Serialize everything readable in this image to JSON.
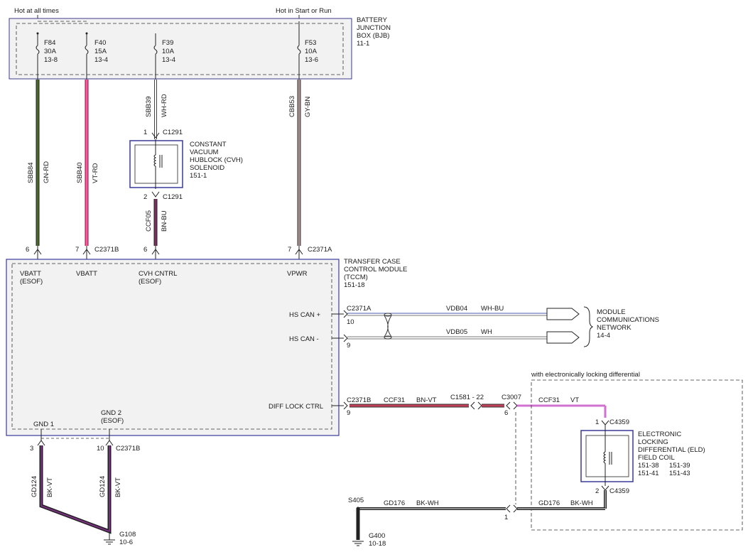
{
  "top": {
    "hot_at_all_times": "Hot at all times",
    "hot_in_start_run": "Hot in Start or Run"
  },
  "bjb": {
    "label_lines": [
      "BATTERY",
      "JUNCTION",
      "BOX (BJB)",
      "11-1"
    ],
    "fuses": [
      {
        "id": "F84",
        "amps": "30A",
        "ref": "13-8"
      },
      {
        "id": "F40",
        "amps": "15A",
        "ref": "13-4"
      },
      {
        "id": "F39",
        "amps": "10A",
        "ref": "13-4"
      },
      {
        "id": "F53",
        "amps": "10A",
        "ref": "13-6"
      }
    ]
  },
  "wires": {
    "sbb84": {
      "circuit": "SBB84",
      "color": "GN-RD",
      "hex": "#4a6a2a"
    },
    "sbb40": {
      "circuit": "SBB40",
      "color": "VT-RD",
      "hex": "#e0287a"
    },
    "sbb39": {
      "circuit": "SBB39",
      "color": "WH-RD"
    },
    "cbb53": {
      "circuit": "CBB53",
      "color": "GY-BN",
      "hex": "#8a7a7a"
    },
    "ccf05": {
      "circuit": "CCF05",
      "color": "BN-BU",
      "hex": "#6a2a4a"
    },
    "vdb04": {
      "circuit": "VDB04",
      "color": "WH-BU"
    },
    "vdb05": {
      "circuit": "VDB05",
      "color": "WH"
    },
    "ccf31_a": {
      "circuit": "CCF31",
      "color": "BN-VT",
      "hex": "#b0304a"
    },
    "ccf31_b": {
      "circuit": "CCF31",
      "color": "VT",
      "hex": "#d060d0"
    },
    "gd124_a": {
      "circuit": "GD124",
      "color": "BK-VT"
    },
    "gd124_b": {
      "circuit": "GD124",
      "color": "BK-VT"
    },
    "gd176_a": {
      "circuit": "GD176",
      "color": "BK-WH"
    },
    "gd176_b": {
      "circuit": "GD176",
      "color": "BK-WH"
    }
  },
  "cvh": {
    "label_lines": [
      "CONSTANT",
      "VACUUM",
      "HUBLOCK (CVH)",
      "SOLENOID",
      "151-1"
    ],
    "pin1": "1",
    "pin2": "2",
    "connector": "C1291"
  },
  "tccm": {
    "label_lines": [
      "TRANSFER CASE",
      "CONTROL MODULE",
      "(TCCM)",
      "151-18"
    ],
    "pins": {
      "vbatt_esof": {
        "pin": "6",
        "name": "VBATT",
        "sub": "(ESOF)"
      },
      "vbatt": {
        "pin": "7",
        "name": "VBATT",
        "conn": "C2371B"
      },
      "cvh_cntrl": {
        "pin": "6",
        "name": "CVH CNTRL",
        "sub": "(ESOF)"
      },
      "vpwr": {
        "pin": "7",
        "name": "VPWR",
        "conn": "C2371A"
      },
      "hs_can_plus": {
        "name": "HS CAN +",
        "pin": "10",
        "conn": "C2371A"
      },
      "hs_can_minus": {
        "name": "HS CAN -",
        "pin": "9"
      },
      "diff_lock": {
        "name": "DIFF LOCK CTRL",
        "pin": "9",
        "conn": "C2371B"
      },
      "gnd1": {
        "name": "GND 1",
        "pin": "3"
      },
      "gnd2": {
        "name": "GND 2",
        "sub": "(ESOF)",
        "pin": "10",
        "conn": "C2371B"
      }
    }
  },
  "network": {
    "label_lines": [
      "MODULE",
      "COMMUNICATIONS",
      "NETWORK",
      "14-4"
    ]
  },
  "inline": {
    "c1581": "C1581 - 22",
    "c3007": "C3007",
    "c3007_pin": "6",
    "c3007_pin_bottom": "1"
  },
  "eld": {
    "optional_label": "with electronically locking differential",
    "label_lines": [
      "ELECTRONIC",
      "LOCKING",
      "DIFFERENTIAL (ELD)",
      "FIELD COIL"
    ],
    "refs": [
      "151-38",
      "151-39",
      "151-41",
      "151-43"
    ],
    "pin1": "1",
    "pin2": "2",
    "connector": "C4359"
  },
  "grounds": {
    "g108": {
      "id": "G108",
      "ref": "10-6"
    },
    "s405": {
      "id": "S405"
    },
    "g400": {
      "id": "G400",
      "ref": "10-18"
    }
  }
}
